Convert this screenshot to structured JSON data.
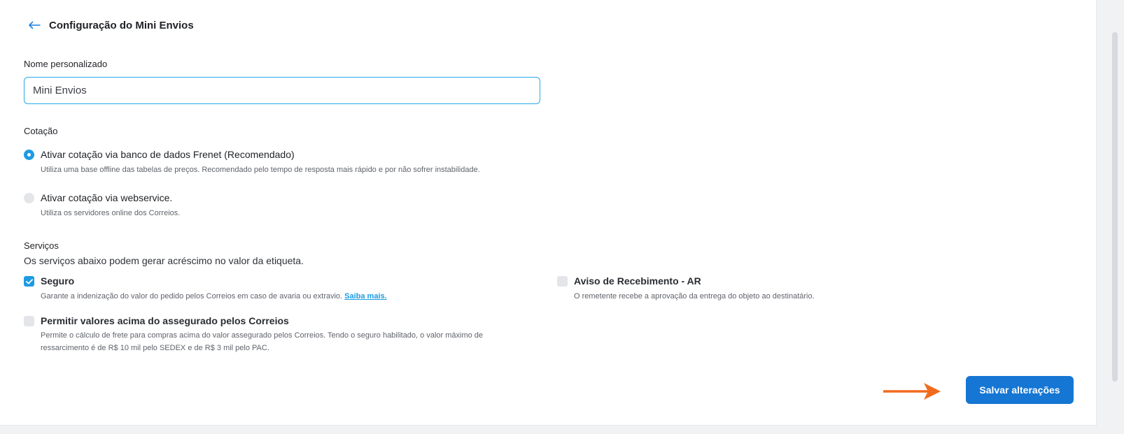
{
  "header": {
    "title": "Configuração do Mini Envios",
    "back_icon": "arrow-left-icon"
  },
  "name_field": {
    "label": "Nome personalizado",
    "value": "Mini Envios"
  },
  "cotacao": {
    "title": "Cotação",
    "options": [
      {
        "label": "Ativar cotação via banco de dados Frenet (Recomendado)",
        "description": "Utiliza uma base offline das tabelas de preços. Recomendado pelo tempo de resposta mais rápido e por não sofrer instabilidade.",
        "selected": true
      },
      {
        "label": "Ativar cotação via webservice.",
        "description": "Utiliza os servidores online dos Correios.",
        "selected": false
      }
    ]
  },
  "servicos": {
    "title": "Serviços",
    "note": "Os serviços abaixo podem gerar acréscimo no valor da etiqueta.",
    "seguro": {
      "label": "Seguro",
      "description": "Garante a indenização do valor do pedido pelos Correios em caso de avaria ou extravio.",
      "link": "Saiba mais.",
      "checked": true
    },
    "aviso": {
      "label": "Aviso de Recebimento - AR",
      "description": "O remetente recebe a aprovação da entrega do objeto ao destinatário.",
      "checked": false
    },
    "permitir": {
      "label": "Permitir valores acima do assegurado pelos Correios",
      "description_line1": "Permite o cálculo de frete para compras acima do valor assegurado pelos Correios. Tendo o seguro habilitado, o valor máximo de",
      "description_line2": "ressarcimento é de R$ 10 mil pelo SEDEX e de R$ 3 mil pelo PAC.",
      "checked": false
    }
  },
  "actions": {
    "save_label": "Salvar alterações"
  },
  "colors": {
    "accent": "#1d9be3",
    "button": "#1576d3",
    "annotation_arrow": "#f26b1d"
  }
}
